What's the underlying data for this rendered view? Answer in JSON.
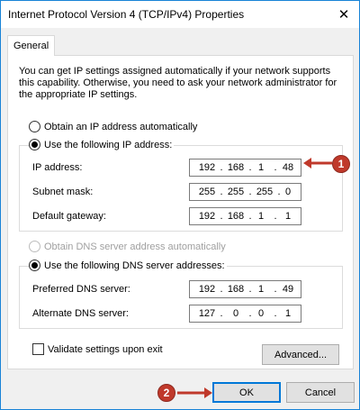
{
  "window": {
    "title": "Internet Protocol Version 4 (TCP/IPv4) Properties",
    "close_glyph": "✕"
  },
  "tabs": [
    {
      "label": "General"
    }
  ],
  "description": "You can get IP settings assigned automatically if your network supports this capability. Otherwise, you need to ask your network administrator for the appropriate IP settings.",
  "ip_section": {
    "obtain_auto_label": "Obtain an IP address automatically",
    "use_following_label": "Use the following IP address:",
    "selected": "use_following",
    "fields": [
      {
        "label": "IP address:",
        "octets": [
          "192",
          "168",
          "1",
          "48"
        ]
      },
      {
        "label": "Subnet mask:",
        "octets": [
          "255",
          "255",
          "255",
          "0"
        ]
      },
      {
        "label": "Default gateway:",
        "octets": [
          "192",
          "168",
          "1",
          "1"
        ]
      }
    ]
  },
  "dns_section": {
    "obtain_auto_label": "Obtain DNS server address automatically",
    "use_following_label": "Use the following DNS server addresses:",
    "selected": "use_following",
    "fields": [
      {
        "label": "Preferred DNS server:",
        "octets": [
          "192",
          "168",
          "1",
          "49"
        ]
      },
      {
        "label": "Alternate DNS server:",
        "octets": [
          "127",
          "0",
          "0",
          "1"
        ]
      }
    ]
  },
  "validate_label": "Validate settings upon exit",
  "validate_checked": false,
  "buttons": {
    "advanced": "Advanced...",
    "ok": "OK",
    "cancel": "Cancel"
  },
  "annotations": {
    "marker_1": "1",
    "marker_2": "2",
    "marker_color": "#c0392b"
  }
}
